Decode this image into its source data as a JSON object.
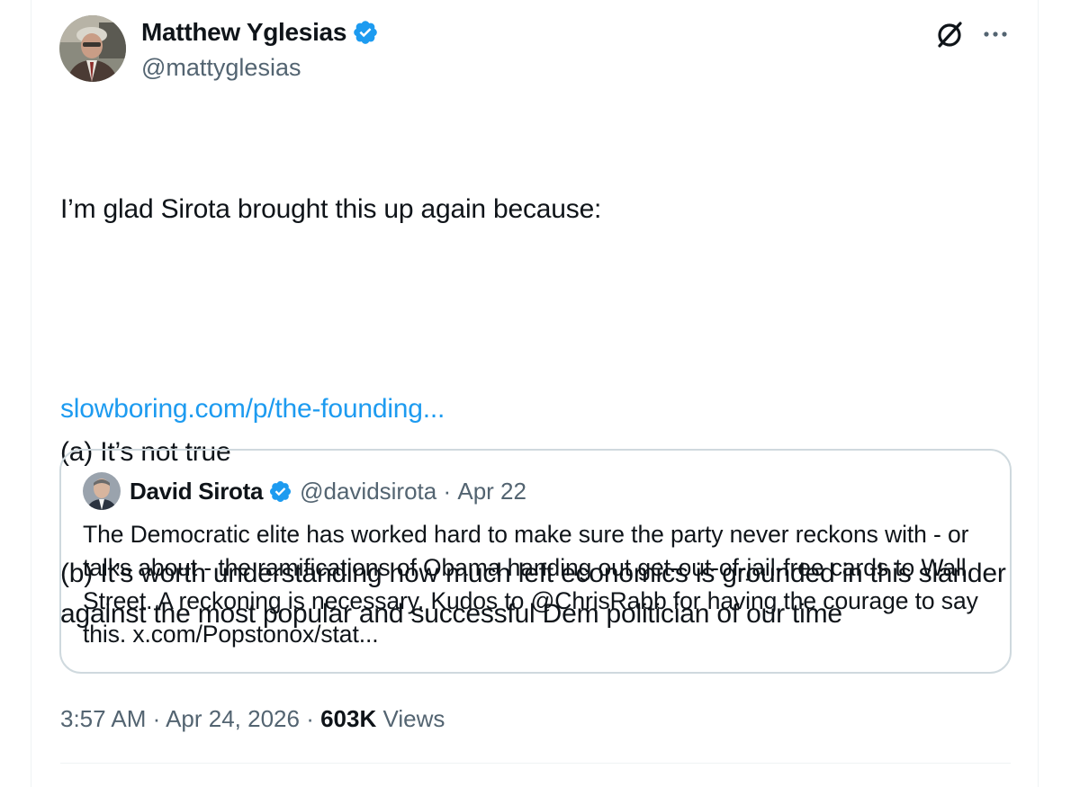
{
  "author": {
    "name": "Matthew Yglesias",
    "handle": "@mattyglesias"
  },
  "tweet": {
    "lines": [
      "I’m glad Sirota brought this up again because:",
      "",
      "(a) It’s not true",
      "(b) It’s worth understanding how much left economics is grounded in this slander against the most popular and successful Dem politician of our time"
    ],
    "link": "slowboring.com/p/the-founding..."
  },
  "quoted": {
    "name": "David Sirota",
    "handle": "@davidsirota",
    "separator": " · ",
    "date": "Apr 22",
    "text": "The Democratic elite has worked hard to make sure the party never reckons with - or talks about - the ramifications of Obama handing out get-out-of-jail-free cards to Wall Street. A reckoning is necessary. Kudos to @ChrisRabb for having the courage to say this. x.com/Popstonox/stat..."
  },
  "footer": {
    "time": "3:57 AM",
    "sep1": " · ",
    "date": "Apr 24, 2026",
    "sep2": " · ",
    "views_count": "603K",
    "views_label": " Views"
  },
  "colors": {
    "accent": "#1d9bf0",
    "secondary_text": "#536471",
    "primary_text": "#0f1419",
    "border": "#cfd9de"
  },
  "icons": {
    "verified": "verified-badge-icon",
    "grok": "grok-icon",
    "more": "more-options-icon"
  }
}
